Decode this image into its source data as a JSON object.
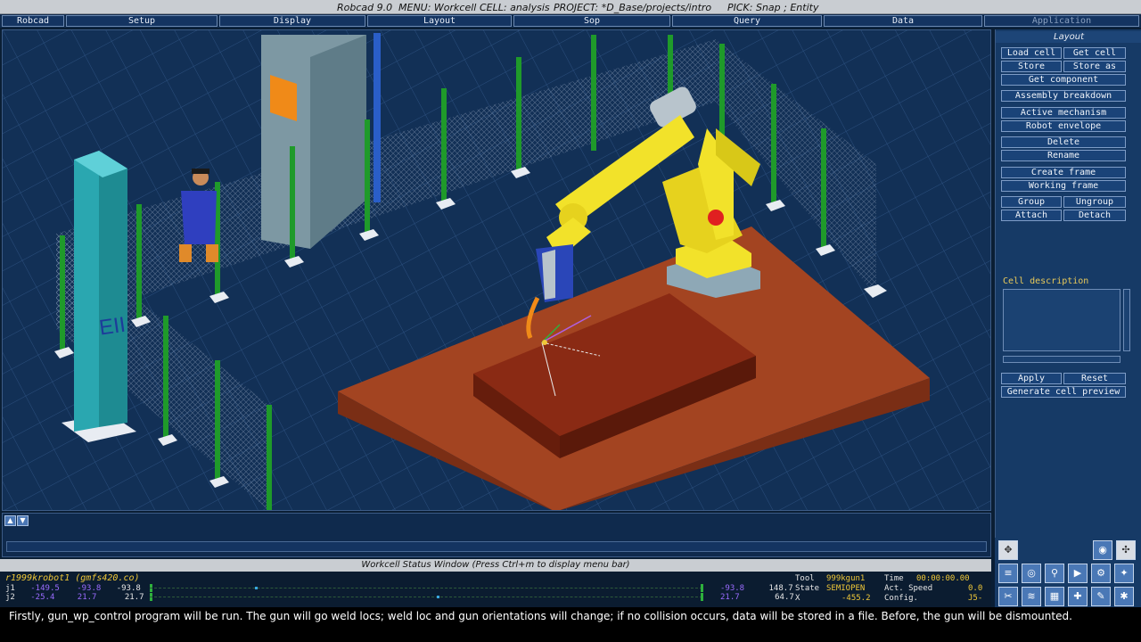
{
  "titlebar": {
    "app": "Robcad 9.0",
    "menu": "MENU: Workcell",
    "cell": "CELL: analysis",
    "project": "PROJECT: *D_Base/projects/intro",
    "pick": "PICK: Snap ; Entity"
  },
  "menubar": {
    "items": [
      "Robcad",
      "Setup",
      "Display",
      "Layout",
      "Sop",
      "Query",
      "Data",
      "Application"
    ]
  },
  "viewport": {
    "column_label": "EII"
  },
  "panel": {
    "title": "Layout",
    "buttons": {
      "load_cell": "Load cell",
      "get_cell": "Get cell",
      "store": "Store",
      "store_as": "Store as",
      "get_component": "Get component",
      "assembly_breakdown": "Assembly breakdown",
      "active_mechanism": "Active mechanism",
      "robot_envelope": "Robot envelope",
      "delete": "Delete",
      "rename": "Rename",
      "create_frame": "Create frame",
      "working_frame": "Working frame",
      "group": "Group",
      "ungroup": "Ungroup",
      "attach": "Attach",
      "detach": "Detach",
      "apply": "Apply",
      "reset": "Reset",
      "generate_cell_preview": "Generate cell preview"
    },
    "cell_description_label": "Cell description",
    "cell_description_value": ""
  },
  "status_window": {
    "title": "Workcell Status Window  (Press Ctrl+m to display menu bar)",
    "robot": "r1999krobot1 (gmfs420.co)",
    "joints": [
      {
        "label": "j1",
        "min": "-149.5",
        "mid": "-93.8",
        "value": "-93.8",
        "rmin": "-93.8",
        "rmax": "148.7",
        "pos": 0.19
      },
      {
        "label": "j2",
        "min": "-25.4",
        "mid": "21.7",
        "value": "21.7",
        "rmin": "21.7",
        "rmax": "64.7",
        "pos": 0.52
      }
    ],
    "tool_label": "Tool",
    "tool_value": "999kgun1",
    "state_label": "State",
    "state_value": "SEMIOPEN",
    "x_label": "X",
    "x_value": "-455.2",
    "time_label": "Time",
    "time_value": "00:00:00.00",
    "speed_label": "Act. Speed",
    "speed_value": "0.0",
    "config_label": "Config.",
    "config_value": "J5-"
  },
  "subtitle": "Firstly, gun_wp_control program will be run. The gun will go weld locs; weld loc and gun orientations will change; if no collision occurs, data will be stored in a file. Before, the gun will be dismounted.",
  "colors": {
    "viewport_bg": "#123056",
    "table_top": "#a34421",
    "fixture": "#8a2a14",
    "robot_yellow": "#f2e22a",
    "fence_post": "#1f9a2a",
    "column_teal": "#2aa7b0"
  }
}
